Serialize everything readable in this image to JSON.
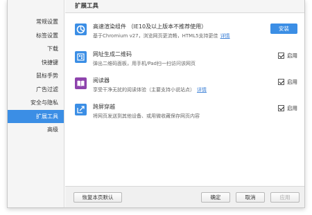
{
  "sidebar": {
    "items": [
      {
        "label": "常规设置"
      },
      {
        "label": "标签设置"
      },
      {
        "label": "下载"
      },
      {
        "label": "快捷键"
      },
      {
        "label": "鼠标手势"
      },
      {
        "label": "广告过滤"
      },
      {
        "label": "安全与隐私"
      },
      {
        "label": "扩展工具",
        "active": true
      },
      {
        "label": "高级"
      }
    ]
  },
  "page": {
    "title": "扩展工具"
  },
  "extensions": [
    {
      "name": "高速渲染组件 （IE10及以上版本不推荐使用）",
      "desc": "基于Chromium v27，浏览网页更流畅，HTML5支持更佳",
      "link": "详情",
      "action": "安装",
      "icon": "render-engine-icon",
      "icon_color": "#3b8ee5"
    },
    {
      "name": "网址生成二维码",
      "desc": "弹出二维码面板，用手机/Pad扫一扫访问该网页",
      "enabled": true,
      "enable_label": "启用",
      "icon": "qrcode-icon",
      "icon_color": "#3b8ee5"
    },
    {
      "name": "阅读器",
      "desc": "享受干净无扰的阅读体验（主要支持小说站点）",
      "link": "详情",
      "enabled": true,
      "enable_label": "启用",
      "icon": "reader-book-icon",
      "icon_color": "#8e44ad"
    },
    {
      "name": "跨屏穿越",
      "desc": "将网页发送到其他设备、或用微收藏保存网页内容",
      "enabled": true,
      "enable_label": "启用",
      "icon": "share-arrow-icon",
      "icon_color": "#3b8ee5"
    }
  ],
  "footer": {
    "restore_label": "恢复本页默认",
    "ok_label": "确定",
    "cancel_label": "取消",
    "apply_label": "应用"
  },
  "colors": {
    "accent": "#3b8ee5",
    "sidebar_bg": "#f5f5f5",
    "link": "#3a7fd6"
  }
}
